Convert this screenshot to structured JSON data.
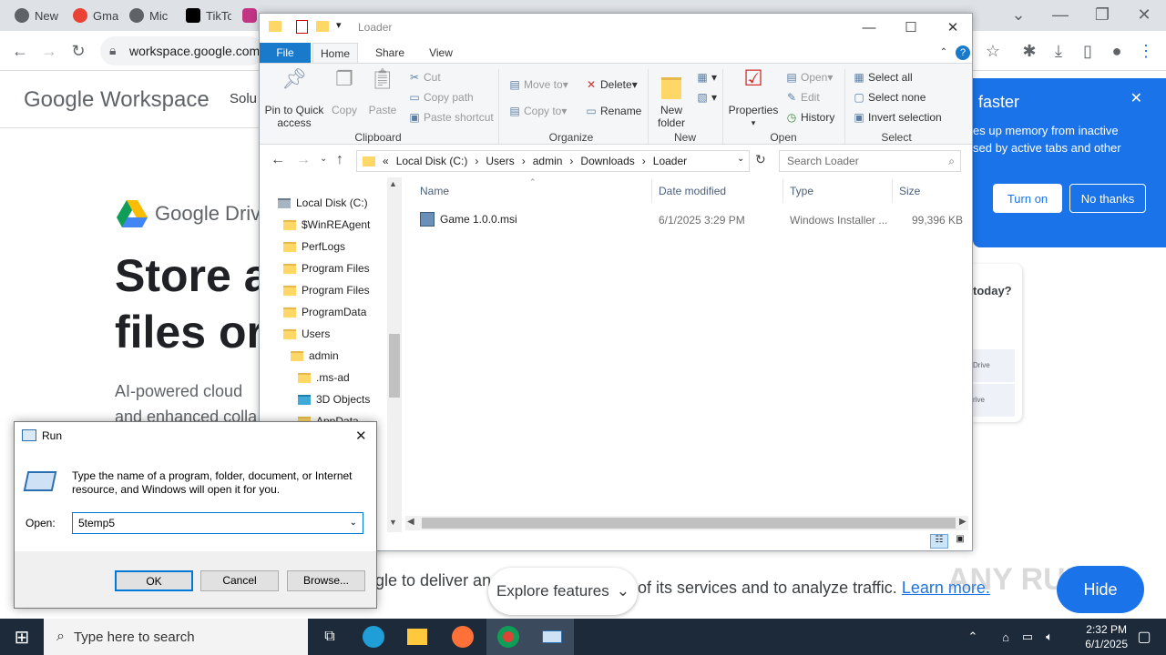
{
  "browser": {
    "tabs": [
      "New",
      "Gma",
      "Mic",
      "TikTo",
      "",
      "",
      "",
      "",
      "",
      "",
      "",
      "",
      ""
    ],
    "url": "workspace.google.com/",
    "colors": {
      "accent": "#1a73e8",
      "tabstrip": "#dee1e6"
    }
  },
  "page": {
    "logo": "Google Workspace",
    "nav_partial": "Solu",
    "product": "Google Driv",
    "headline_1": "Store a",
    "headline_2": "files or",
    "sub_1": "AI-powered cloud",
    "sub_2": "and enhanced colla",
    "cookie_text": "gle to deliver an",
    "cookie_text_2": "of its services and to analyze traffic.",
    "cookie_link": "Learn more.",
    "explore_label": "Explore features",
    "hide_label": "Hide",
    "watermark": "ANY RUN",
    "promo": {
      "title": "faster",
      "body_1": "es up memory from inactive",
      "body_2": "sed by active tabs and other",
      "turn_on": "Turn on",
      "no_thanks": "No thanks"
    },
    "card": {
      "question": "today?",
      "row1": "Drive",
      "row2": "rive"
    }
  },
  "explorer": {
    "title": "Loader",
    "tabs": {
      "file": "File",
      "home": "Home",
      "share": "Share",
      "view": "View"
    },
    "ribbon": {
      "pin": "Pin to Quick access",
      "copy": "Copy",
      "paste": "Paste",
      "cut": "Cut",
      "copy_path": "Copy path",
      "paste_shortcut": "Paste shortcut",
      "clipboard": "Clipboard",
      "move_to": "Move to",
      "copy_to": "Copy to",
      "delete": "Delete",
      "rename": "Rename",
      "organize": "Organize",
      "new_folder": "New folder",
      "new": "New",
      "properties": "Properties",
      "open": "Open",
      "edit": "Edit",
      "history": "History",
      "open_group": "Open",
      "select_all": "Select all",
      "select_none": "Select none",
      "invert": "Invert selection",
      "select": "Select"
    },
    "breadcrumb": [
      "Local Disk (C:)",
      "Users",
      "admin",
      "Downloads",
      "Loader"
    ],
    "search_placeholder": "Search Loader",
    "nav": [
      {
        "label": "Local Disk (C:)",
        "indent": 0
      },
      {
        "label": "$WinREAgent",
        "indent": 1
      },
      {
        "label": "PerfLogs",
        "indent": 1
      },
      {
        "label": "Program Files",
        "indent": 1
      },
      {
        "label": "Program Files",
        "indent": 1
      },
      {
        "label": "ProgramData",
        "indent": 1
      },
      {
        "label": "Users",
        "indent": 1
      },
      {
        "label": "admin",
        "indent": 2
      },
      {
        "label": ".ms-ad",
        "indent": 3
      },
      {
        "label": "3D Objects",
        "indent": 3
      },
      {
        "label": "AppData",
        "indent": 3
      }
    ],
    "columns": {
      "name": "Name",
      "date": "Date modified",
      "type": "Type",
      "size": "Size"
    },
    "files": [
      {
        "name": "Game 1.0.0.msi",
        "date": "6/1/2025 3:29 PM",
        "type": "Windows Installer ...",
        "size": "99,396 KB"
      }
    ]
  },
  "run": {
    "title": "Run",
    "description": "Type the name of a program, folder, document, or Internet resource, and Windows will open it for you.",
    "open_label": "Open:",
    "value": "5temp5",
    "ok": "OK",
    "cancel": "Cancel",
    "browse": "Browse..."
  },
  "taskbar": {
    "search_placeholder": "Type here to search",
    "time": "2:32 PM",
    "date": "6/1/2025"
  }
}
